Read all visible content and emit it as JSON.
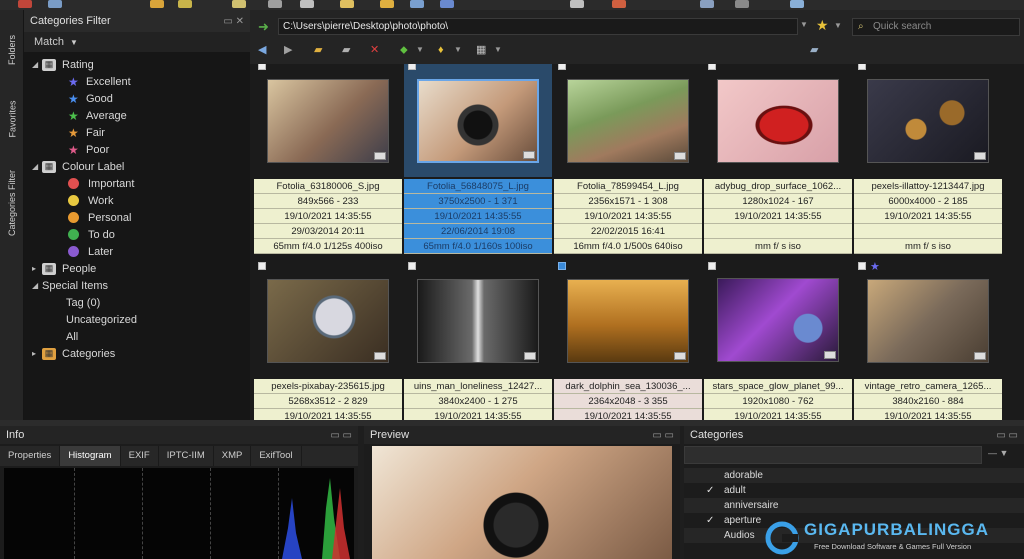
{
  "toolbar": {
    "path": "C:\\Users\\pierre\\Desktop\\photo\\photo\\",
    "search_placeholder": "Quick search",
    "yellow": "#e8c23a"
  },
  "left_tabs": [
    "Folders",
    "Favorites",
    "Categories Filter"
  ],
  "categories_panel": {
    "title": "Categories Filter",
    "match_label": "Match",
    "tree": {
      "rating": "Rating",
      "excellent": "Excellent",
      "good": "Good",
      "average": "Average",
      "fair": "Fair",
      "poor": "Poor",
      "colour_label": "Colour Label",
      "important": "Important",
      "work": "Work",
      "personal": "Personal",
      "todo": "To do",
      "later": "Later",
      "people": "People",
      "special_items": "Special Items",
      "tag": "Tag (0)",
      "uncategorized": "Uncategorized",
      "all": "All",
      "categories": "Categories"
    }
  },
  "thumbnails": [
    {
      "name": "Fotolia_63180006_S.jpg",
      "dims": "849x566 - 233",
      "date1": "19/10/2021 14:35:55",
      "date2": "29/03/2014 20:11",
      "exif": "65mm f/4.0 1/125s 400iso"
    },
    {
      "name": "Fotolia_56848075_L.jpg",
      "dims": "3750x2500 - 1 371",
      "date1": "19/10/2021 14:35:55",
      "date2": "22/06/2014 19:08",
      "exif": "65mm f/4.0 1/160s 100iso",
      "selected": true
    },
    {
      "name": "Fotolia_78599454_L.jpg",
      "dims": "2356x1571 - 1 308",
      "date1": "19/10/2021 14:35:55",
      "date2": "22/02/2015 16:41",
      "exif": "16mm f/4.0 1/500s 640iso"
    },
    {
      "name": "adybug_drop_surface_1062...",
      "dims": "1280x1024 - 167",
      "date1": "19/10/2021 14:35:55",
      "date2": "",
      "exif": "mm f/ s iso"
    },
    {
      "name": "pexels-illattoy-1213447.jpg",
      "dims": "6000x4000 - 2 185",
      "date1": "19/10/2021 14:35:55",
      "date2": "",
      "exif": "mm f/ s iso"
    },
    {
      "name": "pexels-pixabay-235615.jpg",
      "dims": "5268x3512 - 2 829",
      "date1": "19/10/2021 14:35:55"
    },
    {
      "name": "uins_man_loneliness_12427...",
      "dims": "3840x2400 - 1 275",
      "date1": "19/10/2021 14:35:55"
    },
    {
      "name": "dark_dolphin_sea_130036_...",
      "dims": "2364x2048 - 3 355",
      "date1": "19/10/2021 14:35:55"
    },
    {
      "name": "stars_space_glow_planet_99...",
      "dims": "1920x1080 - 762",
      "date1": "19/10/2021 14:35:55"
    },
    {
      "name": "vintage_retro_camera_1265...",
      "dims": "3840x2160 - 884",
      "date1": "19/10/2021 14:35:55"
    }
  ],
  "info_panel": {
    "title": "Info",
    "tabs": [
      "Properties",
      "Histogram",
      "EXIF",
      "IPTC-IIM",
      "XMP",
      "ExifTool"
    ],
    "active_tab": "Histogram"
  },
  "preview_panel": {
    "title": "Preview"
  },
  "categories_list_panel": {
    "title": "Categories",
    "items": [
      {
        "label": "adorable",
        "checked": ""
      },
      {
        "label": "adult",
        "checked": "✓"
      },
      {
        "label": "anniversaire",
        "checked": ""
      },
      {
        "label": "aperture",
        "checked": "✓"
      },
      {
        "label": "Audios",
        "checked": ""
      }
    ]
  },
  "watermark": {
    "brand": "GIGAPURBALINGGA",
    "tagline": "Free Download Software & Games Full Version"
  }
}
